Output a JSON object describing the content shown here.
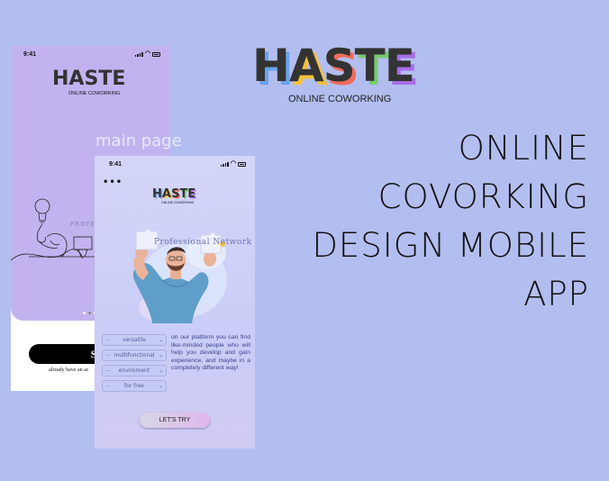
{
  "brand": {
    "letters": [
      "H",
      "A",
      "S",
      "T",
      "E"
    ],
    "tagline": "ONLINE COWORKING"
  },
  "headline": {
    "lines": [
      "ONLINE",
      "COVORKING",
      "DESIGN MOBILE",
      "APP"
    ]
  },
  "screen_label": "main page",
  "back_screen": {
    "time": "9:41",
    "logo_tagline": "ONLINE COWORKING",
    "partial_text": "PROFESS",
    "signin_label": "Sign",
    "already_text": "already have an ac"
  },
  "front_screen": {
    "time": "9:41",
    "menu_glyph": "•••",
    "logo_tagline": "ONLINE COWORKING",
    "heading": "Professional Network",
    "options": [
      {
        "label": "versatile"
      },
      {
        "label": "multifunctional"
      },
      {
        "label": "enviroment"
      },
      {
        "label": "for free"
      }
    ],
    "description": "on our platform you can find like-minded people who will help you develop and gain experience, and maybe in a completely different way!",
    "cta_label": "LET'S TRY"
  },
  "colors": {
    "background": "#b3bef0",
    "back_phone_accent": "#c2b3f0",
    "front_phone_bg": "#d4d6f8",
    "logo_shadow_colors": [
      "#6aa3ea",
      "#f5c23c",
      "#ef6c5a",
      "#78c96e",
      "#a76de8"
    ]
  },
  "icons": [
    "signal-icon",
    "wifi-icon",
    "battery-icon",
    "menu-dots-icon",
    "chevron-down-icon"
  ]
}
